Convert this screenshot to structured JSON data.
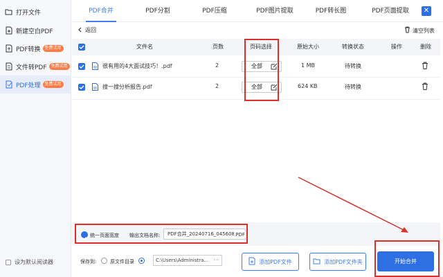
{
  "sidebar": {
    "items": [
      {
        "label": "打开文件",
        "badge": "",
        "icon": "folder-open-icon"
      },
      {
        "label": "新建空白PDF",
        "badge": "",
        "icon": "pdf-new-icon"
      },
      {
        "label": "PDF转换",
        "badge": "免费试用",
        "icon": "pdf-convert-icon"
      },
      {
        "label": "文件转PDF",
        "badge": "免费试用",
        "icon": "file-convert-icon"
      },
      {
        "label": "PDF处理",
        "badge": "免费试用",
        "icon": "pdf-process-icon"
      }
    ],
    "default_reader_label": "设为默认阅读器"
  },
  "tabs": [
    "PDF合并",
    "PDF分割",
    "PDF压缩",
    "PDF图片提取",
    "PDF转长图",
    "PDF页面提取"
  ],
  "toolbar": {
    "back_label": "返回",
    "clear_label": "清空列表"
  },
  "table": {
    "headers": [
      "文件名",
      "页数",
      "页码选择",
      "原始大小",
      "转换状态",
      "操作",
      "删除"
    ],
    "rows": [
      {
        "name": "很有用的4大面试技巧！.pdf",
        "pages": "2",
        "page_select": "全部",
        "size": "1 MB",
        "status": "待转换"
      },
      {
        "name": "搜一搜分析报告.pdf",
        "pages": "2",
        "page_select": "全部",
        "size": "624 KB",
        "status": "待转换"
      }
    ]
  },
  "footer": {
    "unify_width_label": "统一页面宽度",
    "output_name_label": "输出文档名称:",
    "output_name_value": "PDF合并_20240716_045608",
    "output_ext": ".PDF",
    "save_to_label": "保存到:",
    "source_dir_label": "原文件目录",
    "path_value": "C:\\Users\\Administra...",
    "path_dots": "···",
    "add_file_label": "添加PDF文件",
    "add_folder_label": "添加PDF文件夹",
    "start_label": "开始合并"
  },
  "colors": {
    "accent": "#2f6fe4",
    "badge": "#ff7a45",
    "annotation": "#d9302c"
  }
}
